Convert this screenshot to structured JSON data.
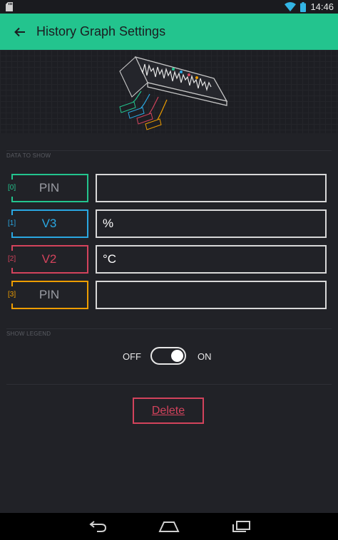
{
  "status_bar": {
    "time": "14:46"
  },
  "header": {
    "title": "History Graph Settings"
  },
  "sections": {
    "data_to_show": "DATA TO SHOW",
    "show_legend": "SHOW LEGEND"
  },
  "rows": [
    {
      "index": "[0]",
      "pin": "PIN",
      "suffix": "",
      "color": "#23c48e",
      "text_color": "#9a9ca3"
    },
    {
      "index": "[1]",
      "pin": "V3",
      "suffix": "%",
      "color": "#2aa7e1",
      "text_color": "#2aa7e1"
    },
    {
      "index": "[2]",
      "pin": "V2",
      "suffix": "°C",
      "color": "#d3435c",
      "text_color": "#d3435c"
    },
    {
      "index": "[3]",
      "pin": "PIN",
      "suffix": "",
      "color": "#ed9d00",
      "text_color": "#9a9ca3"
    }
  ],
  "legend": {
    "off_label": "OFF",
    "on_label": "ON",
    "enabled": true
  },
  "actions": {
    "delete_label": "Delete"
  },
  "colors": {
    "accent": "#23c48e",
    "delete": "#d3435c"
  }
}
